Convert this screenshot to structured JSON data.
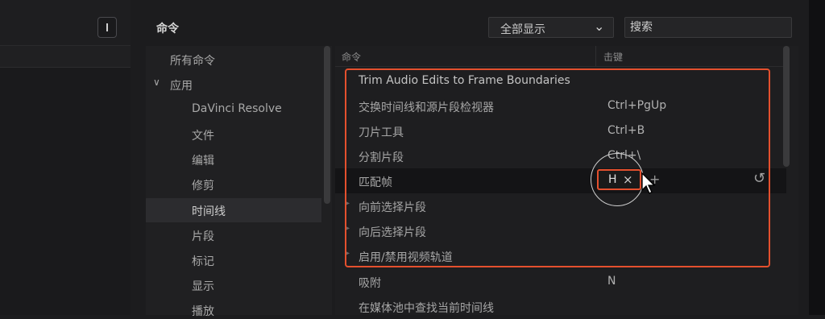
{
  "header": {
    "title": "命令",
    "show_filter": "全部显示",
    "search_placeholder": "搜索"
  },
  "categories": [
    {
      "label": "所有命令",
      "expanded": null
    },
    {
      "label": "应用",
      "expanded": true
    },
    {
      "label": "DaVinci Resolve"
    },
    {
      "label": "文件"
    },
    {
      "label": "编辑"
    },
    {
      "label": "修剪"
    },
    {
      "label": "时间线",
      "selected": true
    },
    {
      "label": "片段"
    },
    {
      "label": "标记"
    },
    {
      "label": "显示"
    },
    {
      "label": "播放"
    }
  ],
  "table": {
    "col_command": "命令",
    "col_key": "击键",
    "rows": [
      {
        "name": "Trim Audio Edits to Frame Boundaries",
        "key": ""
      },
      {
        "name": "交换时间线和源片段检视器",
        "key": "Ctrl+PgUp"
      },
      {
        "name": "刀片工具",
        "key": "Ctrl+B"
      },
      {
        "name": "分割片段",
        "key": "Ctrl+\\"
      },
      {
        "name": "匹配帧",
        "key": "H",
        "editing": true
      },
      {
        "name": "向前选择片段",
        "key": ""
      },
      {
        "name": "向后选择片段",
        "key": ""
      },
      {
        "name": "启用/禁用视频轨道",
        "key": ""
      },
      {
        "name": "吸附",
        "key": "N"
      },
      {
        "name": "在媒体池中查找当前时间线",
        "key": ""
      }
    ]
  },
  "icons": {
    "chevron": "chevron-down-icon",
    "expand": "chevron-down-icon",
    "clear": "close-icon",
    "add": "plus-icon",
    "reset": "reset-icon",
    "cursor": "mouse-cursor-icon"
  },
  "colors": {
    "highlight": "#e4502e",
    "background": "#1c1c1e"
  }
}
